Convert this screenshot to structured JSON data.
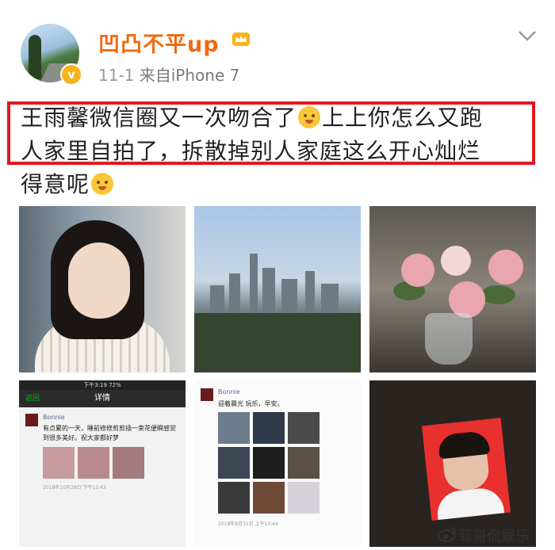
{
  "post": {
    "username": "凹凸不平up",
    "time": "11-1",
    "source": "来自iPhone 7",
    "content_lines": [
      "王雨馨微信圈又一次吻合了",
      "上上你怎么又跑",
      "人家里自拍了，拆散掉别人家庭这么开心灿烂",
      "得意呢"
    ]
  },
  "grid": {
    "cell4": {
      "status": "下午3:19",
      "battery": "72%",
      "back": "返回",
      "title": "详情",
      "name": "Bonnie",
      "text": "有点累的一天，睡前修修剪剪插一束花便瞬感觉到很多美好。祝大家都好梦",
      "date": "2018年10月28日 下午11:43"
    },
    "cell5": {
      "name": "Bonnie",
      "text": "迎着晨光 玩乐，早安。",
      "date": "2018年8月31日 上午10:44"
    }
  },
  "watermark": "菲哥侃娱乐",
  "colors": {
    "username": "#f06a12",
    "highlight": "#e0191f",
    "meta": "#9a9a9a"
  },
  "icons": [
    "verified-badge-icon",
    "crown-icon",
    "chevron-down-icon",
    "weibo-icon"
  ]
}
